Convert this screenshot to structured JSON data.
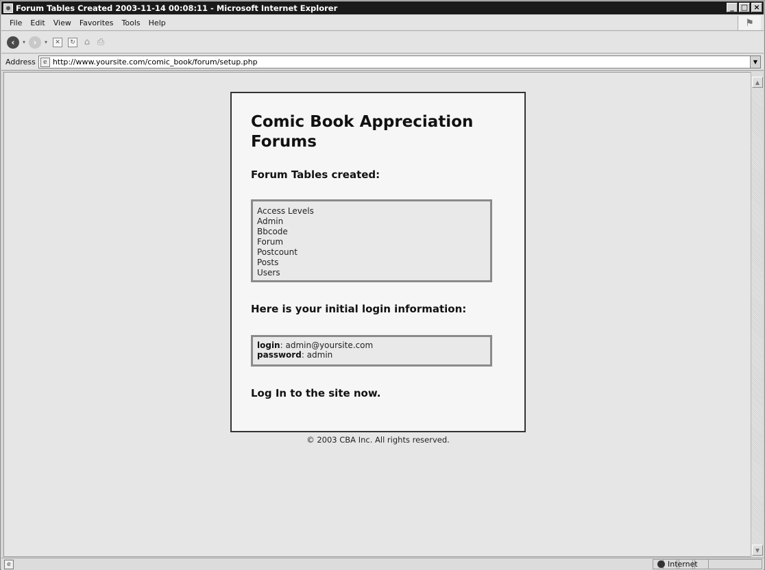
{
  "window": {
    "title": "Forum Tables Created 2003-11-14 00:08:11 - Microsoft Internet Explorer",
    "controls": [
      "_",
      "□",
      "×"
    ]
  },
  "menu": [
    "File",
    "Edit",
    "View",
    "Favorites",
    "Tools",
    "Help"
  ],
  "address": {
    "label": "Address",
    "url": "http://www.yoursite.com/comic_book/forum/setup.php"
  },
  "page": {
    "title": "Comic Book Appreciation Forums",
    "tables_heading": "Forum Tables created:",
    "tables": [
      "Access Levels",
      "Admin",
      "Bbcode",
      "Forum",
      "Postcount",
      "Posts",
      "Users"
    ],
    "login_heading": "Here is your initial login information:",
    "login": {
      "login_label": "login",
      "login_value": ": admin@yoursite.com",
      "password_label": "password",
      "password_value": ": admin"
    },
    "login_link": "Log In to the site now.",
    "footer": "© 2003 CBA Inc. All rights reserved."
  },
  "status": {
    "zone": "Internet"
  },
  "icons": {
    "app": "ie-page-icon",
    "back": "back-arrow-icon",
    "forward": "forward-arrow-icon",
    "stop": "stop-icon",
    "refresh": "refresh-icon",
    "home": "home-icon",
    "print": "print-icon",
    "globe": "globe-icon"
  }
}
